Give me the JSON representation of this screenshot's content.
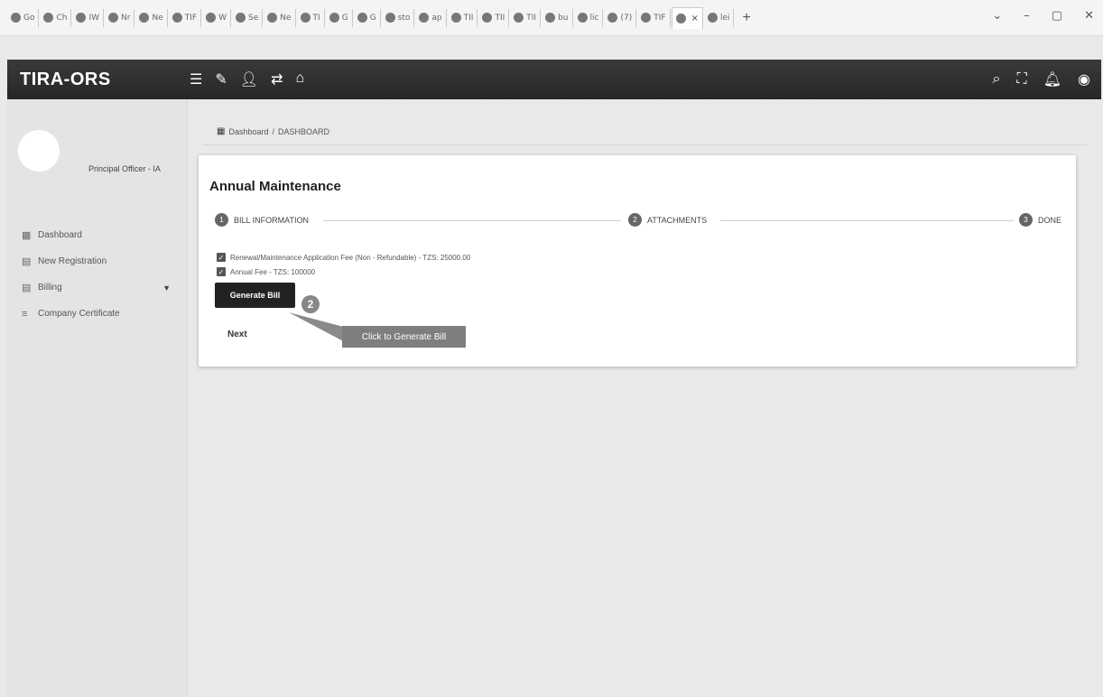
{
  "browser": {
    "tabs": [
      "Go",
      "Ch",
      "IW",
      "Nr",
      "Ne",
      "TIF",
      "W",
      "Se",
      "Ne",
      "TI",
      "G",
      "G",
      "sto",
      "ap",
      "TII",
      "TII",
      "TII",
      "bu",
      "lic",
      "(7)",
      "TIF",
      "",
      "lei"
    ],
    "new_tab": "+",
    "controls": [
      "⌄",
      "–",
      "▢",
      "✕"
    ]
  },
  "app": {
    "brand": "TIRA-ORS",
    "header_icons": [
      "menu-icon",
      "pin-icon",
      "user-icon",
      "transfer-icon",
      "home-icon"
    ],
    "header_right_icons": [
      "search-icon",
      "fullscreen-icon",
      "bell-icon",
      "account-icon"
    ]
  },
  "sidebar": {
    "profile_name": "Principal Officer - IA",
    "items": [
      {
        "label": "Dashboard",
        "icon": "grid-icon"
      },
      {
        "label": "New Registration",
        "icon": "table-icon"
      },
      {
        "label": "Billing",
        "icon": "table-icon",
        "has_dropdown": true
      },
      {
        "label": "Company Certificate",
        "icon": "list-icon"
      }
    ]
  },
  "breadcrumb": {
    "root": "Dashboard",
    "separator": "/",
    "current": "DASHBOARD"
  },
  "card": {
    "title": "Annual Maintenance",
    "steps": [
      {
        "number": "1",
        "label": "BILL INFORMATION"
      },
      {
        "number": "2",
        "label": "ATTACHMENTS"
      },
      {
        "number": "3",
        "label": "DONE"
      }
    ],
    "fees": [
      {
        "label": "Renewal/Maintenance Application Fee (Non - Refundable) - TZS: 25000.00",
        "checked": true
      },
      {
        "label": "Annual Fee - TZS: 100000",
        "checked": true
      }
    ],
    "generate_button": "Generate Bill",
    "next_button": "Next"
  },
  "annotation": {
    "marker": "2",
    "tooltip": "Click to Generate Bill"
  }
}
